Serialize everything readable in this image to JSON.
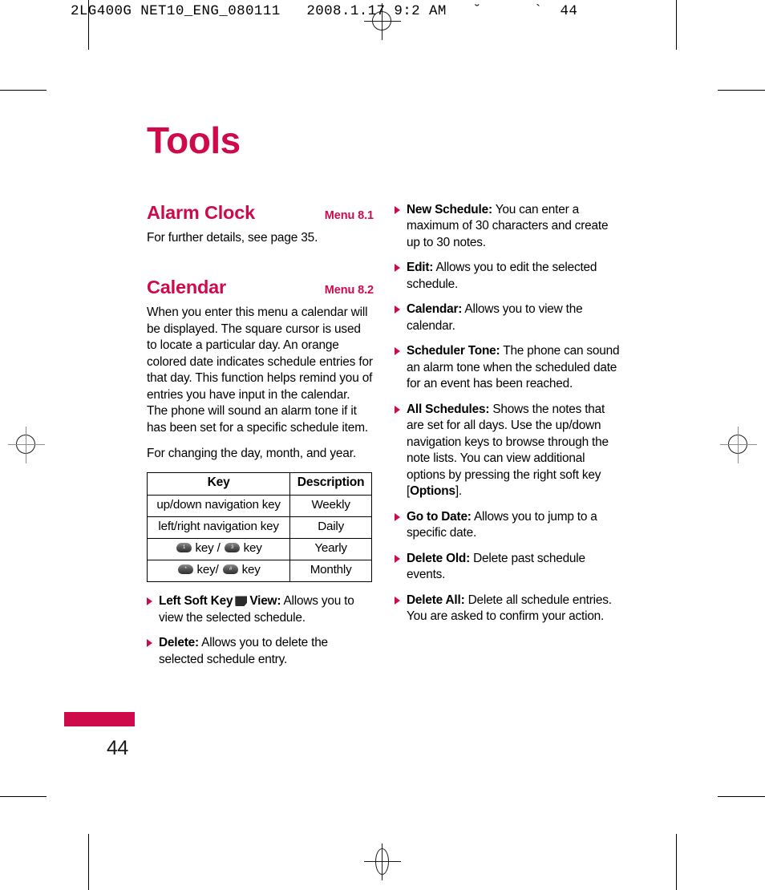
{
  "header_slug": "2LG400G NET10_ENG_080111   2008.1.17 9:2 AM   ˘      `  44",
  "colors": {
    "accent": "#cf0a4b",
    "text": "#000000",
    "folio": "#1a1a1a"
  },
  "chapter": {
    "title": "Tools"
  },
  "left_column": {
    "sections": [
      {
        "title": "Alarm Clock",
        "menu": "Menu 8.1",
        "paragraphs": [
          "For further details, see page 35."
        ]
      },
      {
        "title": "Calendar",
        "menu": "Menu 8.2",
        "paragraphs": [
          "When you enter this menu a calendar will be displayed. The square cursor is used to locate a particular day. An orange colored date indicates schedule entries for that day. This function helps remind you of entries you have input in the calendar. The phone will sound an alarm tone if it has been set for a specific schedule item.",
          "For changing the day, month, and year."
        ]
      }
    ],
    "key_table": {
      "headers": [
        "Key",
        "Description"
      ],
      "rows": [
        {
          "key_text": "up/down navigation key",
          "key_icons": [],
          "description": "Weekly"
        },
        {
          "key_text": "left/right navigation key",
          "key_icons": [],
          "description": "Daily"
        },
        {
          "key_text": "key / key",
          "key_icons": [
            "1",
            "3"
          ],
          "description": "Yearly"
        },
        {
          "key_text": "key/ key",
          "key_icons": [
            "*",
            "#"
          ],
          "description": "Monthly"
        }
      ]
    },
    "bullets": [
      {
        "label": "Left Soft Key",
        "has_softkey_icon": true,
        "label2": "View:",
        "text": "Allows you to view the selected schedule."
      },
      {
        "label": "Delete:",
        "has_softkey_icon": false,
        "label2": "",
        "text": "Allows you to delete the selected schedule entry."
      }
    ]
  },
  "right_column": {
    "bullets": [
      {
        "label": "New Schedule:",
        "text": "You can enter a maximum of 30 characters and create up to 30 notes."
      },
      {
        "label": "Edit:",
        "text": "Allows you to edit the selected schedule."
      },
      {
        "label": "Calendar:",
        "text": "Allows you to view the calendar."
      },
      {
        "label": "Scheduler Tone:",
        "text": "The phone can sound an alarm tone when the scheduled date for an event has been reached."
      },
      {
        "label": "All Schedules:",
        "text_part1": "Shows the notes that are set for all days. Use the up/down navigation keys to browse through the note lists. You can view additional options by pressing the right soft key [",
        "emphasis": "Options",
        "text_part2": "]."
      },
      {
        "label": "Go to Date:",
        "text": "Allows you to jump to a specific date."
      },
      {
        "label": "Delete Old:",
        "text": "Delete past schedule events."
      },
      {
        "label": "Delete All:",
        "text": "Delete all schedule entries. You are asked to confirm your action."
      }
    ]
  },
  "folio": {
    "page_number": "44"
  }
}
